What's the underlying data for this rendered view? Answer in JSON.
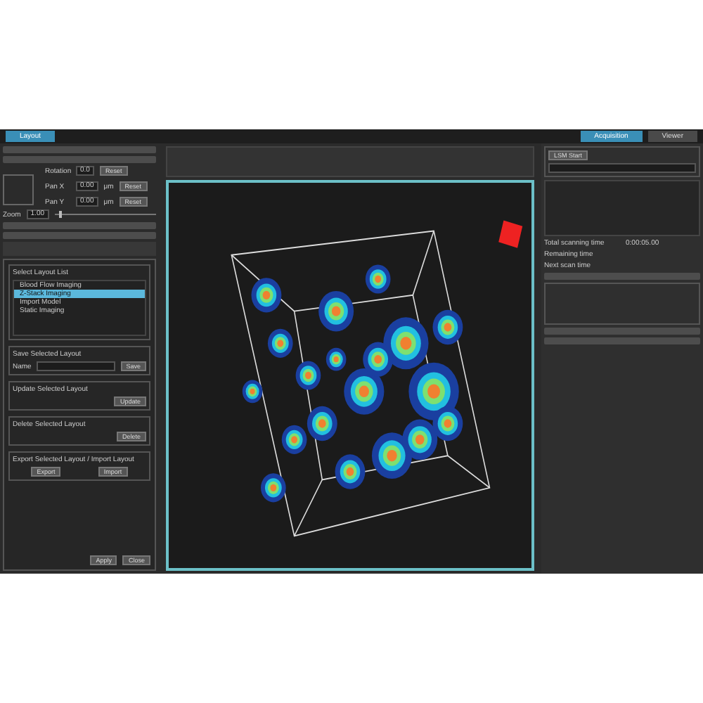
{
  "layout_tab": {
    "label": "Layout",
    "selected": true
  },
  "mode_tabs": [
    {
      "label": "Acquisition",
      "selected": true
    },
    {
      "label": "Viewer",
      "selected": false
    }
  ],
  "view_controls": [
    {
      "label": "Rotation",
      "value": "0.0",
      "button": "Reset"
    },
    {
      "label": "Pan X",
      "value": "0.00",
      "unit": "μm",
      "button": "Reset"
    },
    {
      "label": "Pan Y",
      "value": "0.00",
      "unit": "μm",
      "button": "Reset"
    }
  ],
  "zoom": {
    "label": "Zoom",
    "value": "1.00",
    "level": 0.05
  },
  "layout_dialog": {
    "list_title": "Select Layout List",
    "items": [
      {
        "label": "Blood Flow Imaging",
        "selected": false
      },
      {
        "label": "Z-Stack Imaging",
        "selected": true
      },
      {
        "label": "Import Model",
        "selected": false
      },
      {
        "label": "Static Imaging",
        "selected": false
      }
    ],
    "groups": [
      {
        "title": "Save Selected Layout",
        "field_label": "Name",
        "buttons": [
          "Save"
        ]
      },
      {
        "title": "Update Selected Layout",
        "buttons": [
          "Update"
        ]
      },
      {
        "title": "Delete Selected Layout",
        "buttons": [
          "Delete"
        ]
      },
      {
        "title": "Export Selected Layout / Import Layout",
        "buttons": [
          "Export",
          "Import"
        ]
      }
    ],
    "footer_buttons": [
      "Apply",
      "Close"
    ]
  },
  "acquisition": {
    "start_button": "LSM Start",
    "times": [
      {
        "label": "Total scanning time",
        "value": "0:00:05.00"
      },
      {
        "label": "Remaining time"
      },
      {
        "label": "Next scan time"
      }
    ]
  }
}
